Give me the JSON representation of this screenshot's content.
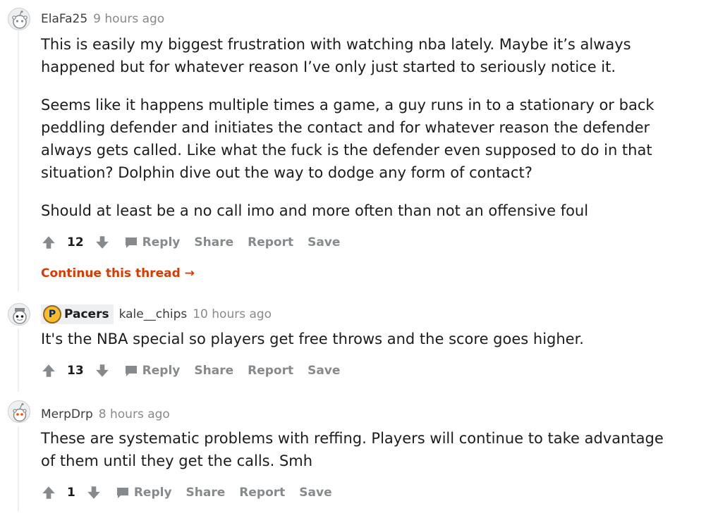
{
  "comments": [
    {
      "author": "ElaFa25",
      "time": "9 hours ago",
      "paragraphs": [
        "This is easily my biggest frustration with watching nba lately. Maybe it’s always happened but for whatever reason I’ve only just started to seriously notice it.",
        "Seems like it happens multiple times a game, a guy runs in to a stationary or back peddling defender and initiates the contact and for whatever reason the defender always gets called. Like what the fuck is the defender even supposed to do in that situation? Dolphin dive out the way to dodge any form of contact?",
        "Should at least be a no call imo and more often than not an offensive foul"
      ],
      "score": "12",
      "continue_label": "Continue this thread →"
    },
    {
      "flair": "Pacers",
      "author": "kale__chips",
      "time": "10 hours ago",
      "paragraphs": [
        "It's the NBA special so players get free throws and the score goes higher."
      ],
      "score": "13"
    },
    {
      "author": "MerpDrp",
      "time": "8 hours ago",
      "paragraphs": [
        "These are systematic problems with reffing. Players will continue to take advantage of them until they get the calls. Smh"
      ],
      "score": "1"
    }
  ],
  "actions": {
    "reply": "Reply",
    "share": "Share",
    "report": "Report",
    "save": "Save"
  },
  "colors": {
    "text": "#1c1c1c",
    "meta": "#878a8c",
    "continue": "#d93a00",
    "thread_line": "#edeff1"
  }
}
